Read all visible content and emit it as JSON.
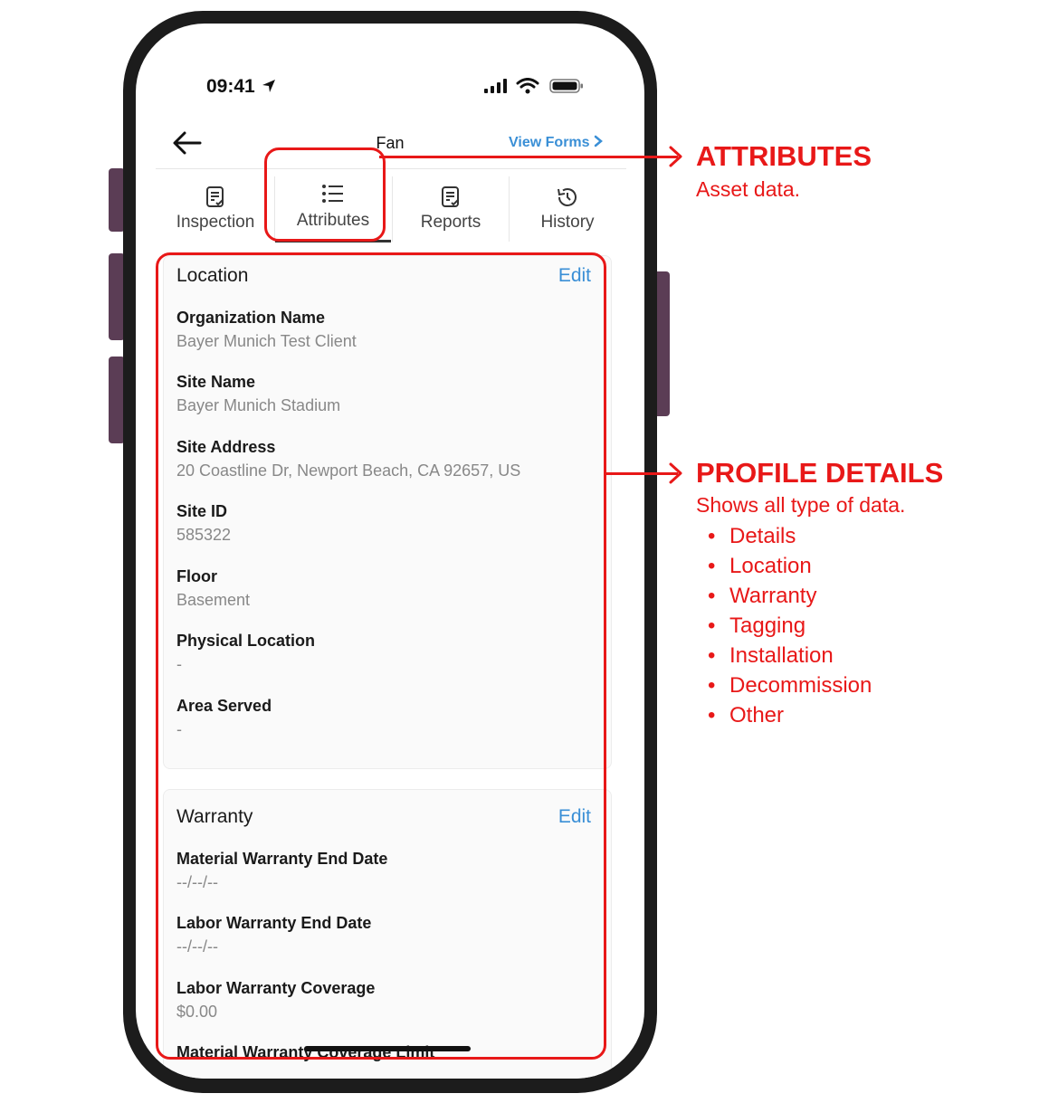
{
  "status_bar": {
    "time": "09:41"
  },
  "nav": {
    "title": "Fan",
    "view_forms_label": "View Forms"
  },
  "tabs": [
    {
      "label": "Inspection",
      "icon": "form-icon"
    },
    {
      "label": "Attributes",
      "icon": "list-icon"
    },
    {
      "label": "Reports",
      "icon": "report-icon"
    },
    {
      "label": "History",
      "icon": "history-icon"
    }
  ],
  "location_card": {
    "title": "Location",
    "edit_label": "Edit",
    "fields": [
      {
        "label": "Organization Name",
        "value": "Bayer Munich Test Client"
      },
      {
        "label": "Site Name",
        "value": "Bayer Munich Stadium"
      },
      {
        "label": "Site Address",
        "value": "20 Coastline Dr, Newport Beach, CA 92657, US"
      },
      {
        "label": "Site ID",
        "value": "585322"
      },
      {
        "label": "Floor",
        "value": "Basement"
      },
      {
        "label": "Physical Location",
        "value": "-"
      },
      {
        "label": "Area Served",
        "value": "-"
      }
    ]
  },
  "warranty_card": {
    "title": "Warranty",
    "edit_label": "Edit",
    "fields": [
      {
        "label": "Material Warranty End Date",
        "value": "--/--/--"
      },
      {
        "label": "Labor Warranty End Date",
        "value": "--/--/--"
      },
      {
        "label": "Labor Warranty Coverage",
        "value": "$0.00"
      },
      {
        "label": "Material Warranty Coverage Limit",
        "value": ""
      }
    ]
  },
  "annotations": {
    "attributes": {
      "title": "ATTRIBUTES",
      "subtitle": "Asset data."
    },
    "profile": {
      "title": "PROFILE DETAILS",
      "subtitle": "Shows all type of data.",
      "items": [
        "Details",
        "Location",
        "Warranty",
        "Tagging",
        "Installation",
        "Decommission",
        "Other"
      ]
    },
    "bullet": "•",
    "color": "#e81818"
  },
  "colors": {
    "accent": "#3a8fd6",
    "phone_frame": "#1c1c1c",
    "side_button": "#5b3d55"
  }
}
